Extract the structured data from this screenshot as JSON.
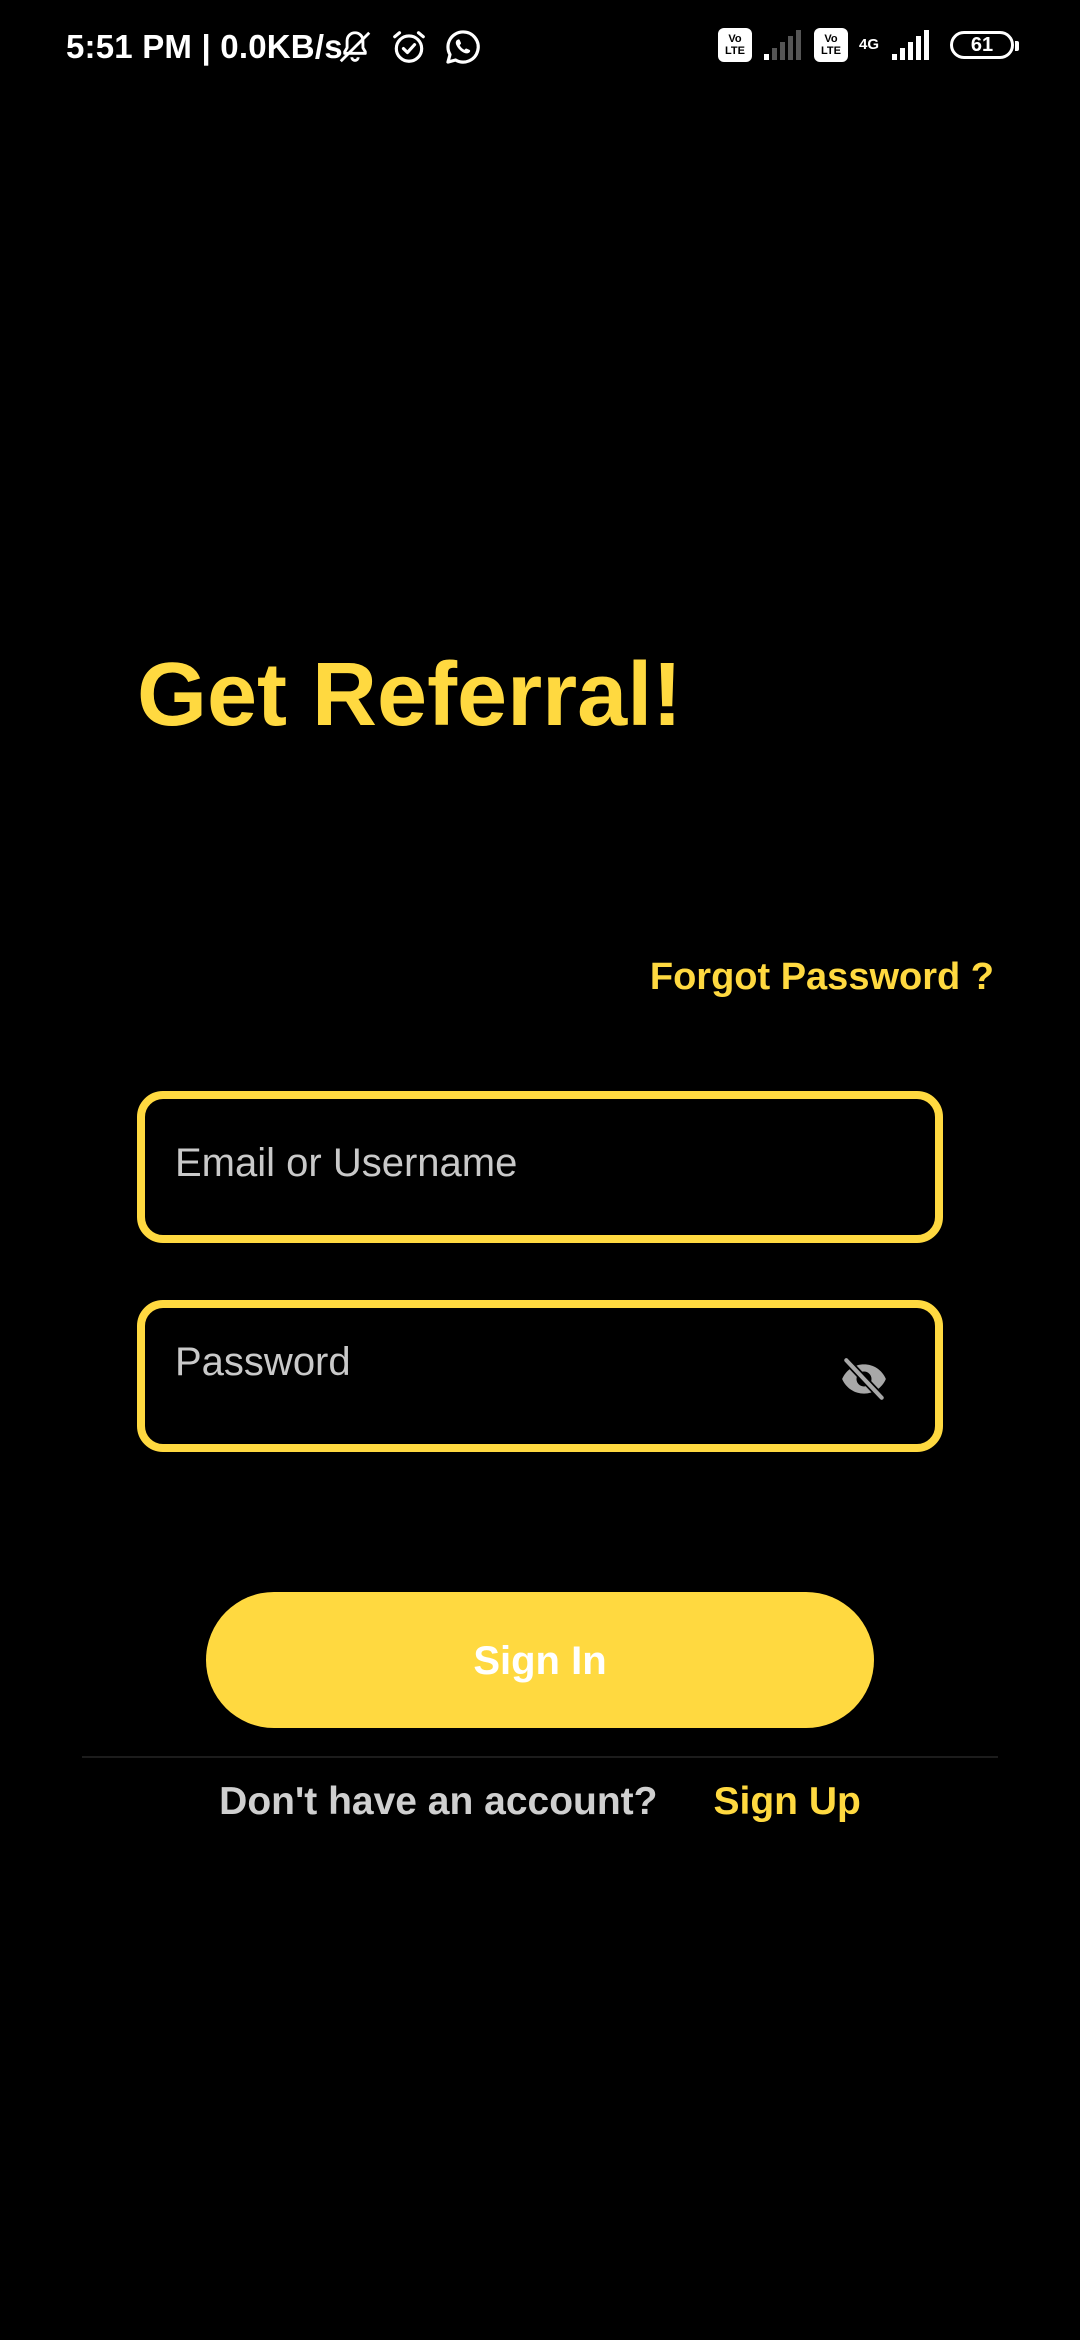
{
  "status_bar": {
    "time": "5:51 PM | 0.0KB/s",
    "icons": [
      "bell-off-icon",
      "alarm-icon",
      "whatsapp-icon"
    ],
    "volte_top": "Vo",
    "volte_bottom": "LTE",
    "network_type": "4G",
    "battery_level": "61"
  },
  "app": {
    "title": "Get Referral!"
  },
  "login": {
    "forgot_password": "Forgot Password ?",
    "email_placeholder": "Email or Username",
    "email_value": "",
    "password_placeholder": "Password",
    "password_value": "",
    "password_toggle_icon": "eye-off-icon",
    "sign_in_label": "Sign In",
    "no_account_prompt": "Don't have an account?",
    "sign_up_label": "Sign Up"
  },
  "colors": {
    "background": "#000000",
    "accent": "#FFD940",
    "text_primary": "#FFFFFF",
    "text_secondary": "#CFCFCF"
  }
}
